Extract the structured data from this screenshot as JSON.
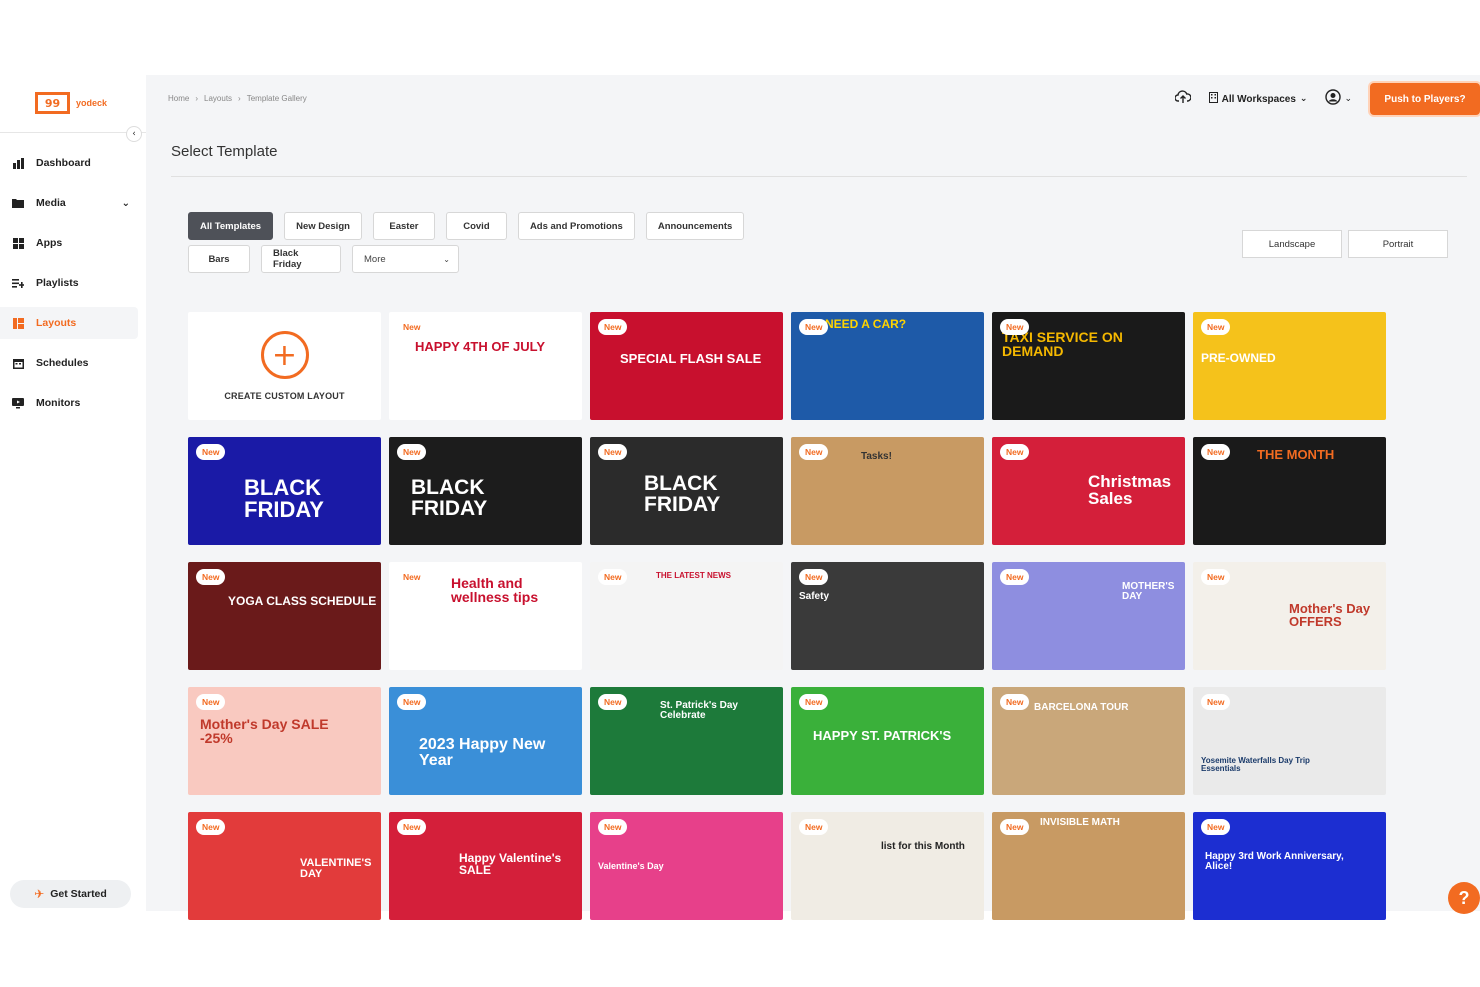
{
  "brand": {
    "logo_mark": "99",
    "name": "yodeck",
    "accent": "#f26b21"
  },
  "sidebar": {
    "items": [
      {
        "label": "Dashboard",
        "icon": "bar-chart-icon"
      },
      {
        "label": "Media",
        "icon": "folder-icon"
      },
      {
        "label": "Apps",
        "icon": "grid-icon"
      },
      {
        "label": "Playlists",
        "icon": "playlist-icon"
      },
      {
        "label": "Layouts",
        "icon": "layout-icon"
      },
      {
        "label": "Schedules",
        "icon": "calendar-icon"
      },
      {
        "label": "Monitors",
        "icon": "monitor-icon"
      }
    ],
    "active": "Layouts",
    "get_started": "Get Started"
  },
  "breadcrumb": [
    "Home",
    "Layouts",
    "Template Gallery"
  ],
  "topbar": {
    "workspaces": "All Workspaces",
    "push_button": "Push to Players?"
  },
  "page_title": "Select Template",
  "filters": {
    "row1": [
      "All Templates",
      "New Design",
      "Easter",
      "Covid",
      "Ads and Promotions",
      "Announcements"
    ],
    "row2": [
      "Bars",
      "Black Friday"
    ],
    "more_select": "More",
    "active": "All Templates"
  },
  "orientation": [
    "Landscape",
    "Portrait"
  ],
  "custom_layout_label": "CREATE CUSTOM LAYOUT",
  "badge_label": "New",
  "templates": [
    {
      "text": "HAPPY 4TH OF JULY",
      "bg": "#ffffff",
      "fg": "#c8102e"
    },
    {
      "text": "SPECIAL FLASH SALE",
      "bg": "#c8102e",
      "fg": "#ffffff"
    },
    {
      "text": "NEED A CAR?",
      "bg": "#1e5aa8",
      "fg": "#ffd400"
    },
    {
      "text": "TAXI SERVICE ON DEMAND",
      "bg": "#1a1a1a",
      "fg": "#f5b800"
    },
    {
      "text": "PRE-OWNED",
      "bg": "#f5c21b",
      "fg": "#ffffff"
    },
    {
      "text": "BLACK FRIDAY",
      "bg": "#1a1aa6",
      "fg": "#ffffff"
    },
    {
      "text": "BLACK FRIDAY",
      "bg": "#1c1c1c",
      "fg": "#ffffff"
    },
    {
      "text": "BLACK FRIDAY",
      "bg": "#2b2b2b",
      "fg": "#ffffff"
    },
    {
      "text": "Tasks!",
      "bg": "#c89a63",
      "fg": "#333333"
    },
    {
      "text": "Christmas Sales",
      "bg": "#d41f3a",
      "fg": "#ffffff"
    },
    {
      "text": "THE MONTH",
      "bg": "#1a1a1a",
      "fg": "#f26b21"
    },
    {
      "text": "YOGA CLASS SCHEDULE",
      "bg": "#6a1a1a",
      "fg": "#ffffff"
    },
    {
      "text": "Health and wellness tips",
      "bg": "#ffffff",
      "fg": "#c8102e"
    },
    {
      "text": "THE LATEST NEWS",
      "bg": "#f4f4f4",
      "fg": "#c8102e"
    },
    {
      "text": "Safety",
      "bg": "#3a3a3a",
      "fg": "#ffffff"
    },
    {
      "text": "MOTHER'S DAY",
      "bg": "#8e8ee0",
      "fg": "#ffffff"
    },
    {
      "text": "Mother's Day OFFERS",
      "bg": "#f3f0ea",
      "fg": "#c0392b"
    },
    {
      "text": "Mother's Day SALE -25%",
      "bg": "#f9c9c0",
      "fg": "#c0392b"
    },
    {
      "text": "2023 Happy New Year",
      "bg": "#3a8fd8",
      "fg": "#ffffff"
    },
    {
      "text": "St. Patrick's Day Celebrate",
      "bg": "#1d7a3a",
      "fg": "#ffffff"
    },
    {
      "text": "HAPPY ST. PATRICK'S",
      "bg": "#3ab03a",
      "fg": "#ffffff"
    },
    {
      "text": "BARCELONA TOUR",
      "bg": "#c9a77a",
      "fg": "#ffffff"
    },
    {
      "text": "Yosemite Waterfalls Day Trip Essentials",
      "bg": "#eaeaea",
      "fg": "#1a3a6a"
    },
    {
      "text": "VALENTINE'S DAY",
      "bg": "#e23b3b",
      "fg": "#ffffff"
    },
    {
      "text": "Happy Valentine's SALE",
      "bg": "#d41f3a",
      "fg": "#ffffff"
    },
    {
      "text": "Valentine's Day",
      "bg": "#e7408a",
      "fg": "#ffffff"
    },
    {
      "text": "list for this Month",
      "bg": "#f0ece4",
      "fg": "#222222"
    },
    {
      "text": "INVISIBLE MATH",
      "bg": "#c89a63",
      "fg": "#ffffff"
    },
    {
      "text": "Happy 3rd Work Anniversary, Alice!",
      "bg": "#1c2ed1",
      "fg": "#ffffff"
    }
  ]
}
